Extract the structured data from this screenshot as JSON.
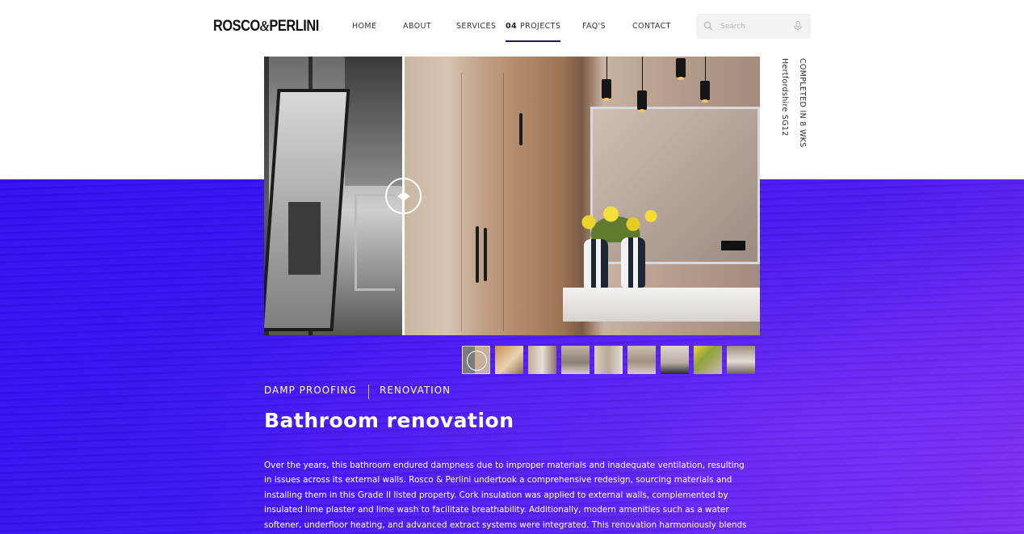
{
  "header": {
    "logo_left": "ROSCO",
    "logo_amp": "&",
    "logo_right": "PERLINI",
    "nav": [
      {
        "label": "HOME"
      },
      {
        "label": "ABOUT"
      },
      {
        "label": "SERVICES"
      },
      {
        "number": "04",
        "label": "PROJECTS",
        "active": true
      },
      {
        "label": "FAQ'S"
      },
      {
        "label": "CONTACT"
      }
    ],
    "search": {
      "placeholder": "Search",
      "value": ""
    }
  },
  "project": {
    "side_info": [
      "COMPLETED IN 8 WKS",
      "Hertfordshire SG12"
    ],
    "tags": [
      "DAMP PROOFING",
      "RENOVATION"
    ],
    "title": "Bathroom renovation",
    "description_lines": [
      "Over the years, this bathroom endured dampness due to improper materials and inadequate ventilation, resulting",
      "in issues across its external walls. Rosco & Perlini undertook a comprehensive redesign, sourcing materials and",
      "installing them in this Grade II listed property. Cork insulation was applied to external walls, complemented by",
      "insulated lime plaster and lime wash to facilitate breathability. Additionally, modern amenities such as a water",
      "softener, underfloor heating, and advanced extract systems were integrated. This renovation harmoniously blends"
    ]
  },
  "colors": {
    "brand_purple": "#3a14f3",
    "purple_end": "#7a2bf2",
    "nav_underline": "#1d1b5a"
  },
  "icons": {
    "search": "search-icon",
    "mic": "microphone-icon",
    "compare_handle": "compare-arrows-icon"
  }
}
